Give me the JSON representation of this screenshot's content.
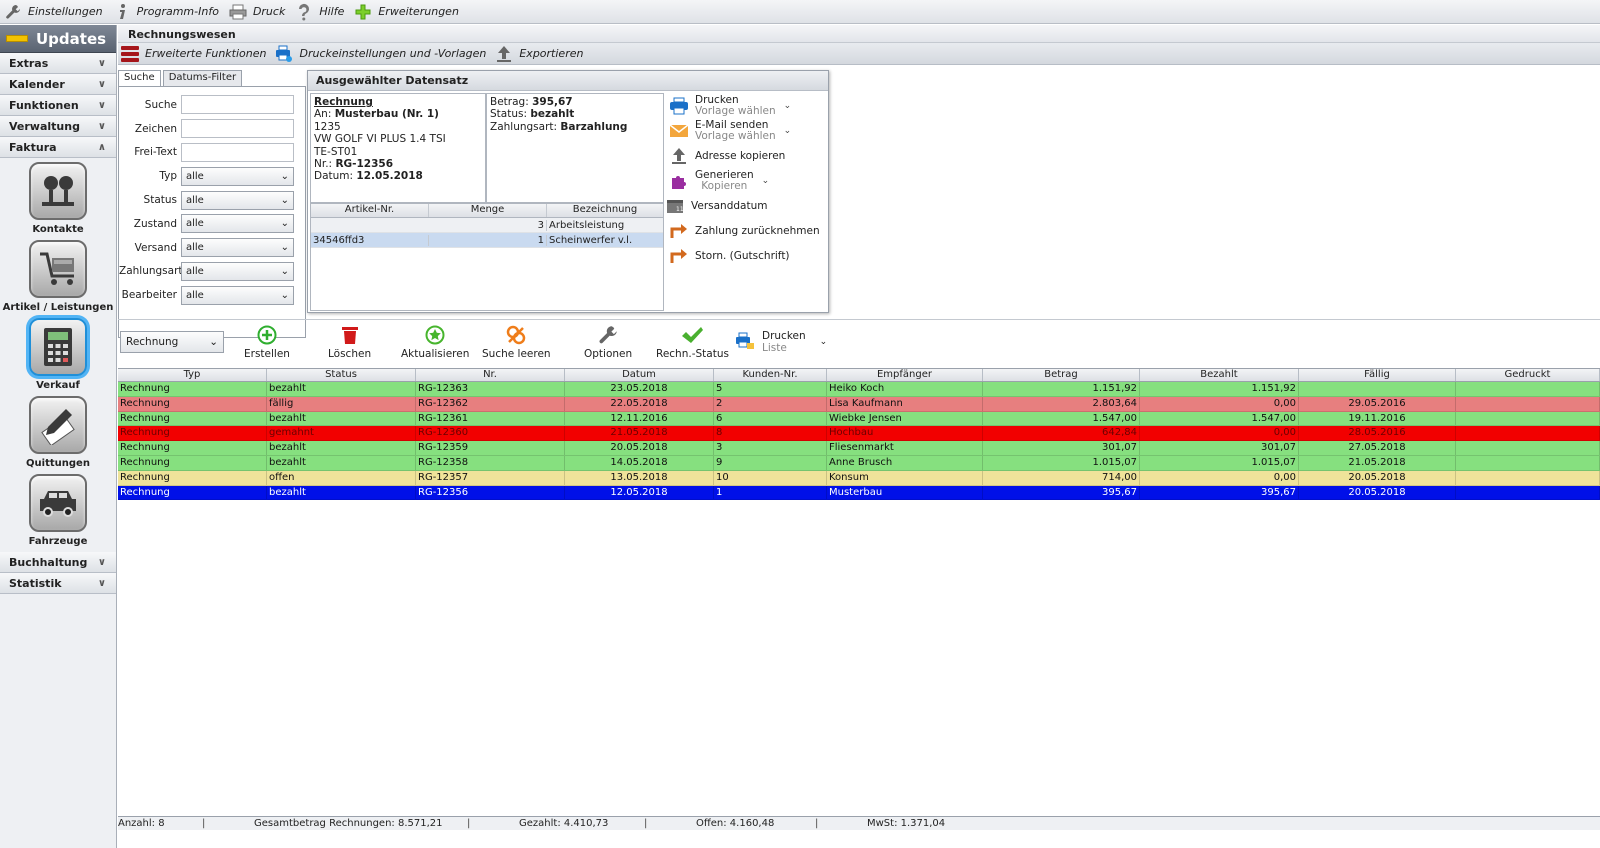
{
  "menu": {
    "items": [
      {
        "label": "Einstellungen",
        "icon": "wrench-icon"
      },
      {
        "label": "Programm-Info",
        "icon": "info-icon"
      },
      {
        "label": "Druck",
        "icon": "printer-icon"
      },
      {
        "label": "Hilfe",
        "icon": "help-icon"
      },
      {
        "label": "Erweiterungen",
        "icon": "plus-icon"
      }
    ]
  },
  "sidebar": {
    "updates_label": "Updates",
    "sections": [
      "Extras",
      "Kalender",
      "Funktionen",
      "Verwaltung",
      "Faktura"
    ],
    "tiles": [
      {
        "label": "Kontakte",
        "icon": "contacts-icon"
      },
      {
        "label": "Artikel / Leistungen",
        "icon": "cart-icon"
      },
      {
        "label": "Verkauf",
        "icon": "calculator-icon"
      },
      {
        "label": "Quittungen",
        "icon": "pen-icon"
      },
      {
        "label": "Fahrzeuge",
        "icon": "car-icon"
      }
    ],
    "sections_bottom": [
      "Buchhaltung",
      "Statistik"
    ]
  },
  "main": {
    "title": "Rechnungswesen",
    "toolbar": {
      "extended": "Erweiterte Funktionen",
      "print_settings": "Druckeinstellungen und -Vorlagen",
      "export": "Exportieren"
    }
  },
  "search": {
    "tab_search": "Suche",
    "tab_date": "Datums-Filter",
    "fields": [
      {
        "label": "Suche",
        "type": "input",
        "value": ""
      },
      {
        "label": "Zeichen",
        "type": "input",
        "value": ""
      },
      {
        "label": "Frei-Text",
        "type": "input",
        "value": ""
      },
      {
        "label": "Typ",
        "type": "select",
        "value": "alle"
      },
      {
        "label": "Status",
        "type": "select",
        "value": "alle"
      },
      {
        "label": "Zustand",
        "type": "select",
        "value": "alle"
      },
      {
        "label": "Versand",
        "type": "select",
        "value": "alle"
      },
      {
        "label": "Zahlungsart",
        "type": "select",
        "value": "alle"
      },
      {
        "label": "Bearbeiter",
        "type": "select",
        "value": "alle"
      }
    ]
  },
  "record": {
    "title": "Ausgewählter Datensatz",
    "doc_type": "Rechnung",
    "to_label": "An:",
    "to_value": "Musterbau (Nr. 1)",
    "line1": "1235",
    "line2": "VW GOLF VI PLUS 1.4 TSI",
    "line3": "TE-ST01",
    "nr_label": "Nr.:",
    "nr_value": "RG-12356",
    "date_label": "Datum:",
    "date_value": "12.05.2018",
    "amount_label": "Betrag:",
    "amount_value": "395,67",
    "status_label": "Status:",
    "status_value": "bezahlt",
    "payment_label": "Zahlungsart:",
    "payment_value": "Barzahlung",
    "table": {
      "headers": [
        "Artikel-Nr.",
        "Menge",
        "Bezeichnung"
      ],
      "rows": [
        [
          "",
          "3",
          "Arbeitsleistung"
        ],
        [
          "34546ffd3",
          "1",
          "Scheinwerfer v.l."
        ]
      ]
    },
    "actions": {
      "print": "Drucken",
      "print_sub": "Vorlage wählen",
      "email": "E-Mail senden",
      "email_sub": "Vorlage wählen",
      "copy_address": "Adresse kopieren",
      "generate": "Generieren",
      "generate_sub": "Kopieren",
      "ship_date": "Versanddatum",
      "revert_payment": "Zahlung zurücknehmen",
      "cancel": "Storn. (Gutschrift)"
    }
  },
  "actionbar": {
    "type_value": "Rechnung",
    "create": "Erstellen",
    "delete": "Löschen",
    "refresh": "Aktualisieren",
    "clear": "Suche leeren",
    "options": "Optionen",
    "status": "Rechn.-Status",
    "print": "Drucken",
    "print_sub": "Liste"
  },
  "grid": {
    "headers": [
      "Typ",
      "Status",
      "Nr.",
      "Datum",
      "Kunden-Nr.",
      "Empfänger",
      "Betrag",
      "Bezahlt",
      "Fällig",
      "Gedruckt"
    ],
    "rows": [
      {
        "cells": [
          "Rechnung",
          "bezahlt",
          "RG-12363",
          "23.05.2018",
          "5",
          "Heiko Koch",
          "1.151,92",
          "1.151,92",
          "",
          ""
        ],
        "bg": "#86e07f",
        "fg": "#111111"
      },
      {
        "cells": [
          "Rechnung",
          "fällig",
          "RG-12362",
          "22.05.2018",
          "2",
          "Lisa Kaufmann",
          "2.803,64",
          "0,00",
          "29.05.2016",
          ""
        ],
        "bg": "#e77f7f",
        "fg": "#111111"
      },
      {
        "cells": [
          "Rechnung",
          "bezahlt",
          "RG-12361",
          "12.11.2016",
          "6",
          "Wiebke Jensen",
          "1.547,00",
          "1.547,00",
          "19.11.2016",
          ""
        ],
        "bg": "#86e07f",
        "fg": "#111111"
      },
      {
        "cells": [
          "Rechnung",
          "gemahnt",
          "RG-12360",
          "21.05.2018",
          "8",
          "Hochbau",
          "642,84",
          "0,00",
          "28.05.2016",
          ""
        ],
        "bg": "#f20000",
        "fg": "#6b0000"
      },
      {
        "cells": [
          "Rechnung",
          "bezahlt",
          "RG-12359",
          "20.05.2018",
          "3",
          "Fliesenmarkt",
          "301,07",
          "301,07",
          "27.05.2018",
          ""
        ],
        "bg": "#86e07f",
        "fg": "#111111"
      },
      {
        "cells": [
          "Rechnung",
          "bezahlt",
          "RG-12358",
          "14.05.2018",
          "9",
          "Anne Brusch",
          "1.015,07",
          "1.015,07",
          "21.05.2018",
          ""
        ],
        "bg": "#86e07f",
        "fg": "#111111"
      },
      {
        "cells": [
          "Rechnung",
          "offen",
          "RG-12357",
          "13.05.2018",
          "10",
          "Konsum",
          "714,00",
          "0,00",
          "20.05.2018",
          ""
        ],
        "bg": "#efe39a",
        "fg": "#111111"
      },
      {
        "cells": [
          "Rechnung",
          "bezahlt",
          "RG-12356",
          "12.05.2018",
          "1",
          "Musterbau",
          "395,67",
          "395,67",
          "20.05.2018",
          ""
        ],
        "bg": "#0010e8",
        "fg": "#ffffff"
      }
    ]
  },
  "status": {
    "count": "Anzahl: 8",
    "total": "Gesamtbetrag Rechnungen: 8.571,21",
    "paid": "Gezahlt: 4.410,73",
    "open": "Offen: 4.160,48",
    "vat": "MwSt: 1.371,04"
  }
}
